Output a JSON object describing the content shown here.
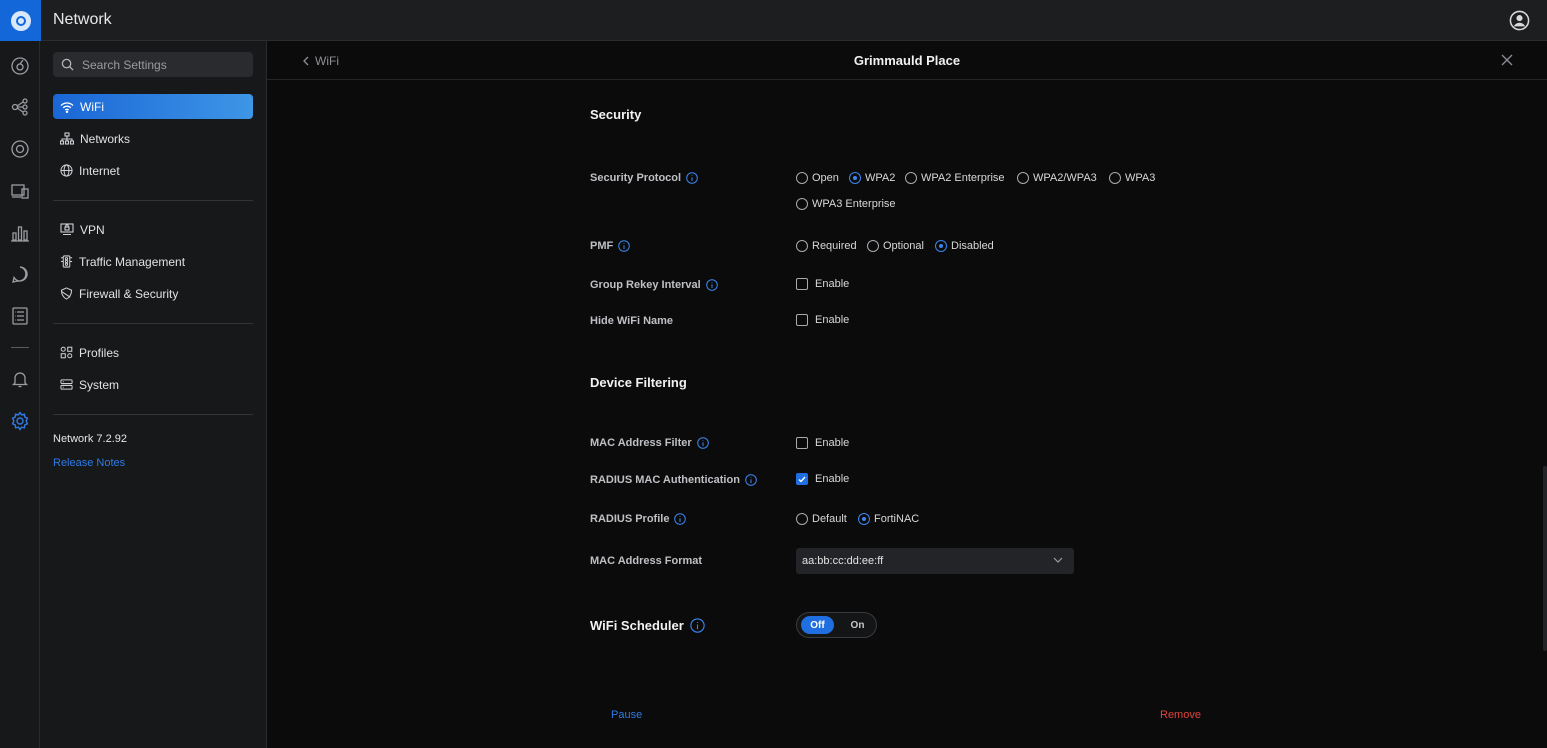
{
  "app": {
    "title": "Network"
  },
  "rail": {
    "icons": [
      "dashboard-icon",
      "topology-icon",
      "devices-icon",
      "clients-icon",
      "statistics-icon",
      "insights-icon",
      "logs-icon",
      "alerts-icon",
      "settings-icon"
    ],
    "active": "settings-icon"
  },
  "sidebar": {
    "search_placeholder": "Search Settings",
    "items": [
      {
        "label": "WiFi",
        "icon": "wifi-icon",
        "active": true
      },
      {
        "label": "Networks",
        "icon": "networks-icon"
      },
      {
        "label": "Internet",
        "icon": "globe-icon"
      },
      {
        "label": "VPN",
        "icon": "vpn-icon"
      },
      {
        "label": "Traffic Management",
        "icon": "traffic-icon"
      },
      {
        "label": "Firewall & Security",
        "icon": "shield-icon"
      },
      {
        "label": "Profiles",
        "icon": "profiles-icon"
      },
      {
        "label": "System",
        "icon": "system-icon"
      }
    ],
    "version": "Network 7.2.92",
    "release_notes": "Release Notes"
  },
  "header": {
    "back_label": "WiFi",
    "title": "Grimmauld Place"
  },
  "security": {
    "title": "Security",
    "protocol": {
      "label": "Security Protocol",
      "options": [
        "Open",
        "WPA2",
        "WPA2 Enterprise",
        "WPA2/WPA3",
        "WPA3",
        "WPA3 Enterprise"
      ],
      "selected": "WPA2"
    },
    "pmf": {
      "label": "PMF",
      "options": [
        "Required",
        "Optional",
        "Disabled"
      ],
      "selected": "Disabled"
    },
    "group_rekey": {
      "label": "Group Rekey Interval",
      "option": "Enable",
      "checked": false
    },
    "hide_name": {
      "label": "Hide WiFi Name",
      "option": "Enable",
      "checked": false
    }
  },
  "device_filtering": {
    "title": "Device Filtering",
    "mac_filter": {
      "label": "MAC Address Filter",
      "option": "Enable",
      "checked": false
    },
    "radius_mac": {
      "label": "RADIUS MAC Authentication",
      "option": "Enable",
      "checked": true
    },
    "radius_profile": {
      "label": "RADIUS Profile",
      "options": [
        "Default",
        "FortiNAC"
      ],
      "selected": "FortiNAC"
    },
    "mac_format": {
      "label": "MAC Address Format",
      "value": "aa:bb:cc:dd:ee:ff"
    }
  },
  "scheduler": {
    "label": "WiFi Scheduler",
    "off": "Off",
    "on": "On",
    "state": "Off"
  },
  "footer": {
    "pause": "Pause",
    "remove": "Remove"
  },
  "colors": {
    "accent": "#1f6fe0",
    "link": "#2f7ae5",
    "danger": "#e0443a"
  }
}
